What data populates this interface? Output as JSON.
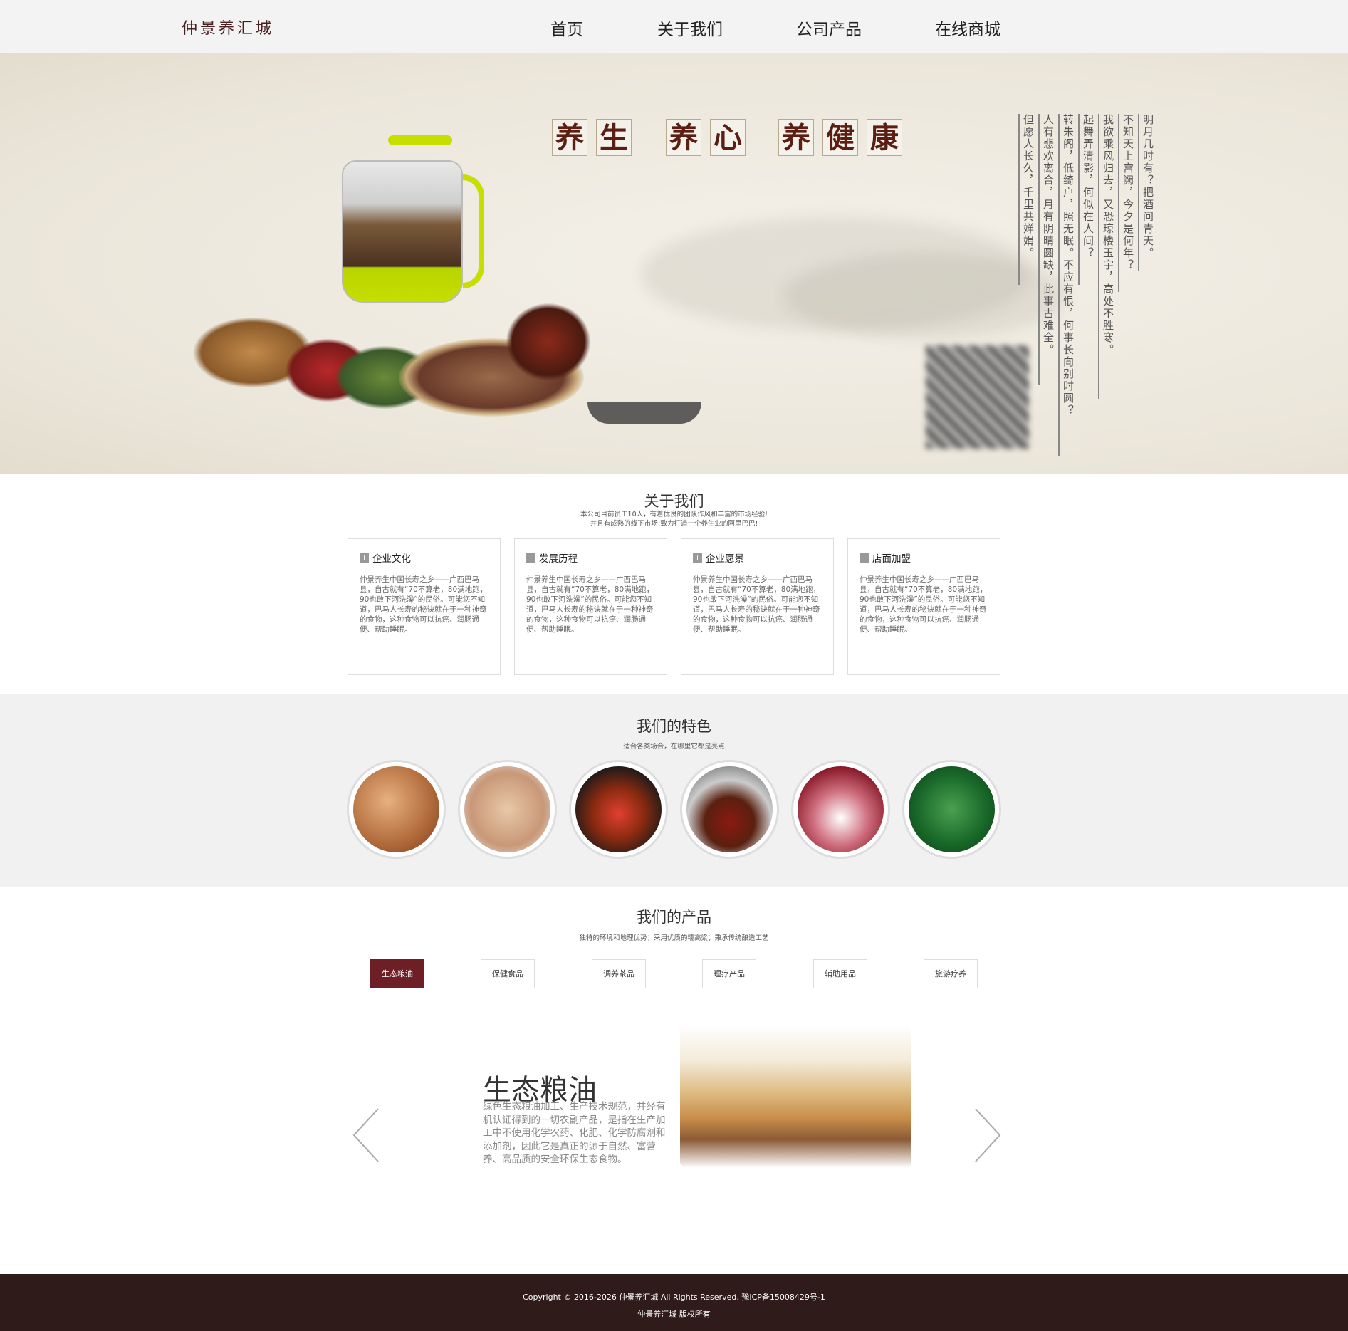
{
  "header": {
    "logo": "仲景养汇城",
    "nav": [
      "首页",
      "关于我们",
      "公司产品",
      "在线商城"
    ]
  },
  "hero": {
    "title_chars": [
      "养",
      "生",
      "养",
      "心",
      "养",
      "健",
      "康"
    ],
    "poem_lines": [
      "明月几时有？把酒问青天。",
      "不知天上宫阙，今夕是何年？",
      "我欲乘风归去，又恐琼楼玉宇，高处不胜寒。",
      "起舞弄清影，何似在人间？",
      "转朱阁，低绮户，照无眠。不应有恨，何事长向别时圆？",
      "人有悲欢离合，月有阴晴圆缺，此事古难全。",
      "但愿人长久，千里共婵娟。"
    ]
  },
  "about": {
    "title": "关于我们",
    "subtitle_lines": [
      "本公司目前员工10人，有着优良的团队作风和丰富的市场经验!",
      "并且有成熟的线下市场!致力打造一个养生业的阿里巴巴!"
    ],
    "cards": [
      {
        "title": "企业文化",
        "text": "仲景养生中国长寿之乡——广西巴马县，自古就有“70不算老，80满地跑，90也敢下河洗澡”的民俗。可能您不知道，巴马人长寿的秘诀就在于一种神奇的食物，这种食物可以抗癌、润肠通便、帮助睡眠。"
      },
      {
        "title": "发展历程",
        "text": "仲景养生中国长寿之乡——广西巴马县，自古就有“70不算老，80满地跑，90也敢下河洗澡”的民俗。可能您不知道，巴马人长寿的秘诀就在于一种神奇的食物，这种食物可以抗癌、润肠通便、帮助睡眠。"
      },
      {
        "title": "企业愿景",
        "text": "仲景养生中国长寿之乡——广西巴马县，自古就有“70不算老，80满地跑，90也敢下河洗澡”的民俗。可能您不知道，巴马人长寿的秘诀就在于一种神奇的食物，这种食物可以抗癌、润肠通便、帮助睡眠。"
      },
      {
        "title": "店面加盟",
        "text": "仲景养生中国长寿之乡——广西巴马县，自古就有“70不算老，80满地跑，90也敢下河洗澡”的民俗。可能您不知道，巴马人长寿的秘诀就在于一种神奇的食物，这种食物可以抗癌、润肠通便、帮助睡眠。"
      }
    ]
  },
  "features": {
    "title": "我们的特色",
    "subtitle": "适合各类场合，在哪里它都是亮点"
  },
  "products": {
    "title": "我们的产品",
    "subtitle": "独特的环境和地理优势；采用优质的糯高粱；秉承传统酿造工艺",
    "tabs": [
      "生态粮油",
      "保健食品",
      "调养茶品",
      "理疗产品",
      "辅助用品",
      "旅游疗养"
    ],
    "active_tab": "生态粮油",
    "slide": {
      "title": "生态粮油",
      "text": "绿色生态粮油加工、生产技术规范，并经有机认证得到的一切农副产品，是指在生产加工中不使用化学农药、化肥、化学防腐剂和添加剂，因此它是真正的源于自然、富营养、高品质的安全环保生态食物。"
    }
  },
  "footer": {
    "copyright": "Copyright © 2016-2026 仲景养汇城 All Rights Reserved, 豫ICP备15008429号-1",
    "rights": "仲景养汇城 版权所有"
  },
  "colors": {
    "accent": "#6e1f25",
    "footer_bg": "#2f1b1a",
    "header_bg": "#f3f3f3"
  }
}
